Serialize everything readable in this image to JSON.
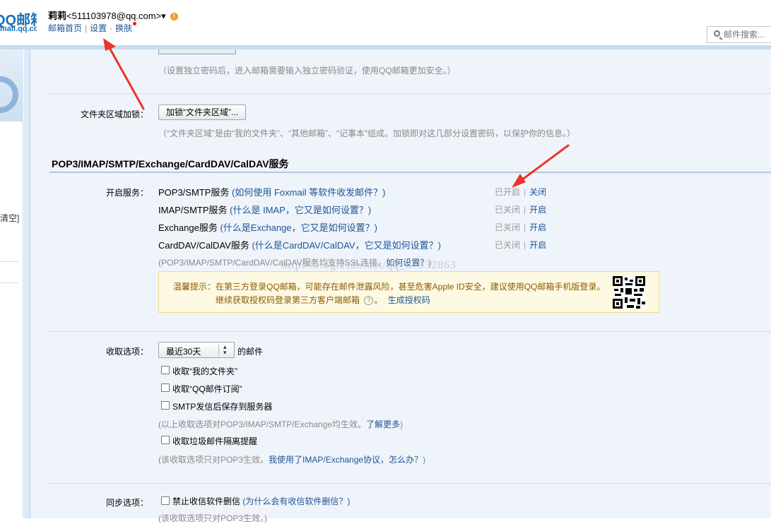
{
  "header": {
    "logo_main": "QQ邮箱",
    "logo_sub": "mail.qq.com",
    "user_nick": "莉莉",
    "user_email": "<511103978@qq.com>",
    "user_caret": "▾",
    "warn_icon": "!",
    "nav": {
      "home": "邮箱首页",
      "settings": "设置",
      "dash": "-",
      "skin": "换肤"
    },
    "search_placeholder": "邮件搜索..."
  },
  "sidebar": {
    "clear_text": "清空]"
  },
  "independent_password": {
    "hint": "（设置独立密码后，进入邮箱需要输入独立密码验证，使用QQ邮箱更加安全。）"
  },
  "folder_lock": {
    "label": "文件夹区域加锁：",
    "button": "加锁“文件夹区域”...",
    "hint": "（“文件夹区域”是由“我的文件夹”、“其他邮箱”、“记事本”组成。加锁即对这几部分设置密码，以保护你的信息。）"
  },
  "section_title": "POP3/IMAP/SMTP/Exchange/CardDAV/CalDAV服务",
  "services": {
    "label": "开启服务：",
    "rows": [
      {
        "name": "POP3/SMTP服务",
        "help_link": "(如何使用 Foxmail 等软件收发邮件？)",
        "status": "已开启",
        "action": "关闭"
      },
      {
        "name": "IMAP/SMTP服务",
        "help_link": "(什么是 IMAP，它又是如何设置？)",
        "status": "已关闭",
        "action": "开启"
      },
      {
        "name": "Exchange服务",
        "help_link": "(什么是Exchange，它又是如何设置？)",
        "status": "已关闭",
        "action": "开启"
      },
      {
        "name": "CardDAV/CalDAV服务",
        "help_link": "(什么是CardDAV/CalDAV，它又是如何设置？)",
        "status": "已关闭",
        "action": "开启"
      }
    ],
    "ssl_hint": "(POP3/IMAP/SMTP/CardDAV/CalDAV服务均支持SSL连接。",
    "ssl_link": "如何设置？",
    "ssl_close": ")",
    "watermark": "http://blog.csdn.net/qq_37932863"
  },
  "tip": {
    "line1": "温馨提示：在第三方登录QQ邮箱，可能存在邮件泄露风险，甚至危害Apple ID安全，建议使用QQ邮箱手机版登录。",
    "line2": "继续获取授权码登录第三方客户端邮箱",
    "help_icon": "?",
    "period": "。",
    "link": "生成授权码"
  },
  "receive": {
    "label": "收取选项：",
    "select_value": "最近30天",
    "suffix": "的邮件",
    "options": [
      {
        "label": "收取“我的文件夹”",
        "checked": false
      },
      {
        "label": "收取“QQ邮件订阅”",
        "checked": false
      },
      {
        "label": "SMTP发信后保存到服务器",
        "checked": false
      }
    ],
    "hint1": "(以上收取选项对POP3/IMAP/SMTP/Exchange均生效。",
    "hint1_link": "了解更多",
    "hint1_close": ")",
    "junk_option": {
      "label": "收取垃圾邮件隔离提醒",
      "checked": false
    },
    "hint2": "(该收取选项只对POP3生效。",
    "hint2_link": "我使用了IMAP/Exchange协议，怎么办？",
    "hint2_close": ")"
  },
  "sync": {
    "label": "同步选项：",
    "option": "禁止收信软件删信",
    "link": "(为什么会有收信软件删信？)",
    "hint": "(该收取选项只对POP3生效。)"
  },
  "colors": {
    "accent": "#1e5494",
    "background": "#eff4fb",
    "arrow": "#e8342a"
  }
}
